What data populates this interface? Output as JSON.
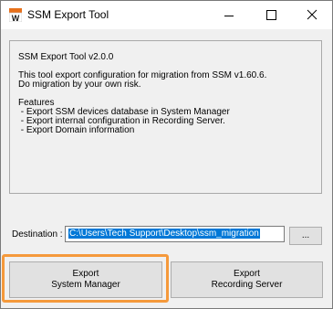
{
  "window": {
    "title": "SSM Export Tool",
    "icon": "app-w-icon",
    "controls": {
      "minimize_icon": "minimize-icon",
      "maximize_icon": "maximize-icon",
      "close_icon": "close-icon"
    }
  },
  "info": {
    "version": "SSM Export Tool v2.0.0",
    "description_1": "This tool export configuration for migration from SSM v1.60.6.",
    "description_2": "Do migration by your own risk.",
    "features_heading": "Features",
    "features": [
      " - Export SSM devices database in System Manager",
      " - Export internal configuration in Recording Server.",
      " - Export Domain information"
    ]
  },
  "destination": {
    "label": "Destination :",
    "value": "C:\\Users\\Tech Support\\Desktop\\ssm_migration",
    "browse_label": "..."
  },
  "buttons": {
    "export_sm_line1": "Export",
    "export_sm_line2": "System Manager",
    "export_rs_line1": "Export",
    "export_rs_line2": "Recording Server"
  },
  "colors": {
    "highlight": "#f5993b",
    "selection": "#0078d7"
  }
}
